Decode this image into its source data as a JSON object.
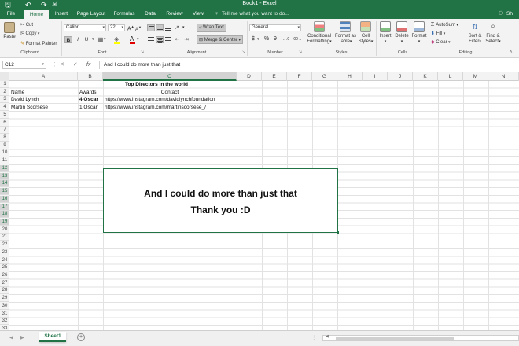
{
  "window": {
    "title": "Book1 - Excel"
  },
  "quick_access": {
    "save": "🖫",
    "undo": "↶",
    "redo": "↷",
    "more": "⇲"
  },
  "tabs": [
    "File",
    "Home",
    "Insert",
    "Page Layout",
    "Formulas",
    "Data",
    "Review",
    "View"
  ],
  "active_tab": "Home",
  "tell_me": "Tell me what you want to do...",
  "share_label": "Sh",
  "ribbon": {
    "clipboard": {
      "paste": "Paste",
      "cut": "Cut",
      "copy": "Copy",
      "format_painter": "Format Painter",
      "label": "Clipboard"
    },
    "font": {
      "name": "Calibri",
      "size": "22",
      "bold": "B",
      "italic": "I",
      "underline": "U",
      "grow": "A",
      "shrink": "A",
      "label": "Font"
    },
    "alignment": {
      "wrap_text": "Wrap Text",
      "merge_center": "Merge & Center",
      "label": "Alignment"
    },
    "number": {
      "format": "General",
      "currency": "$",
      "percent": "%",
      "comma": "9",
      "inc_decimal": "←.0",
      "dec_decimal": ".00→",
      "label": "Number"
    },
    "styles": {
      "conditional": "Conditional",
      "conditional2": "Formatting",
      "format_as": "Format as",
      "format_as2": "Table",
      "cell_styles": "Cell",
      "cell_styles2": "Styles",
      "label": "Styles"
    },
    "cells": {
      "insert": "Insert",
      "delete": "Delete",
      "format": "Format",
      "label": "Cells"
    },
    "editing": {
      "autosum": "AutoSum",
      "fill": "Fill",
      "clear": "Clear",
      "sort": "Sort &",
      "sort2": "Filter",
      "find": "Find &",
      "find2": "Select",
      "label": "Editing"
    }
  },
  "formula_bar": {
    "name_box": "C12",
    "cancel": "✕",
    "enter": "✓",
    "fx": "fx",
    "content": "And I could do more than just that"
  },
  "columns": [
    "A",
    "B",
    "C",
    "D",
    "E",
    "F",
    "G",
    "H",
    "I",
    "J",
    "K",
    "L",
    "M",
    "N"
  ],
  "selected_column": "C",
  "rows": [
    "1",
    "2",
    "3",
    "4",
    "5",
    "6",
    "7",
    "8",
    "9",
    "10",
    "11",
    "12",
    "13",
    "14",
    "15",
    "16",
    "17",
    "18",
    "19",
    "20",
    "21",
    "22",
    "23",
    "24",
    "25",
    "26",
    "27",
    "28",
    "29",
    "30",
    "31",
    "32",
    "33"
  ],
  "selected_rows": [
    "12",
    "13",
    "14",
    "15",
    "16",
    "17",
    "18",
    "19"
  ],
  "cells": {
    "title": "Top Directors in the world",
    "header_name": "Name",
    "header_awards": "Awards",
    "header_contact": "Contact",
    "r3_name": "David Lynch",
    "r3_awards": "4 Oscar",
    "r3_contact": "https://www.instagram.com/davidlynchfoundation",
    "r4_name": "Martin Scorsese",
    "r4_awards": "1 Oscar",
    "r4_contact": "https://www.instagram.com/martinscorsese_/"
  },
  "textbox": {
    "line1": "And I could do more than just that",
    "line2": "Thank you :D"
  },
  "sheets": {
    "active": "Sheet1",
    "add": "+"
  },
  "colors": {
    "brand": "#217346",
    "ribbon_bg": "#f3f3f3"
  }
}
